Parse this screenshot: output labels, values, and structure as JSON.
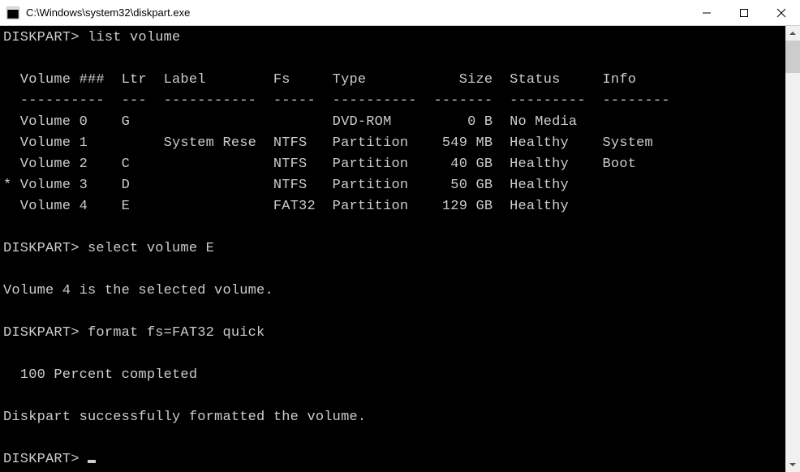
{
  "window": {
    "title": "C:\\Windows\\system32\\diskpart.exe"
  },
  "session": {
    "prompt": "DISKPART>",
    "commands": {
      "list_volume": "list volume",
      "select_volume": "select volume E",
      "format": "format fs=FAT32 quick"
    },
    "table": {
      "header": {
        "volume": "Volume ###",
        "ltr": "Ltr",
        "label": "Label",
        "fs": "Fs",
        "type": "Type",
        "size": "Size",
        "status": "Status",
        "info": "Info"
      },
      "sep": {
        "volume": "----------",
        "ltr": "---",
        "label": "-----------",
        "fs": "-----",
        "type": "----------",
        "size": "-------",
        "status": "---------",
        "info": "--------"
      },
      "rows": [
        {
          "sel": " ",
          "volume": "Volume 0",
          "ltr": "G",
          "label": "",
          "fs": "",
          "type": "DVD-ROM",
          "size": "0 B",
          "status": "No Media",
          "info": ""
        },
        {
          "sel": " ",
          "volume": "Volume 1",
          "ltr": "",
          "label": "System Rese",
          "fs": "NTFS",
          "type": "Partition",
          "size": "549 MB",
          "status": "Healthy",
          "info": "System"
        },
        {
          "sel": " ",
          "volume": "Volume 2",
          "ltr": "C",
          "label": "",
          "fs": "NTFS",
          "type": "Partition",
          "size": "40 GB",
          "status": "Healthy",
          "info": "Boot"
        },
        {
          "sel": "*",
          "volume": "Volume 3",
          "ltr": "D",
          "label": "",
          "fs": "NTFS",
          "type": "Partition",
          "size": "50 GB",
          "status": "Healthy",
          "info": ""
        },
        {
          "sel": " ",
          "volume": "Volume 4",
          "ltr": "E",
          "label": "",
          "fs": "FAT32",
          "type": "Partition",
          "size": "129 GB",
          "status": "Healthy",
          "info": ""
        }
      ]
    },
    "messages": {
      "selected": "Volume 4 is the selected volume.",
      "progress": "  100 Percent completed",
      "success": "Diskpart successfully formatted the volume."
    }
  }
}
